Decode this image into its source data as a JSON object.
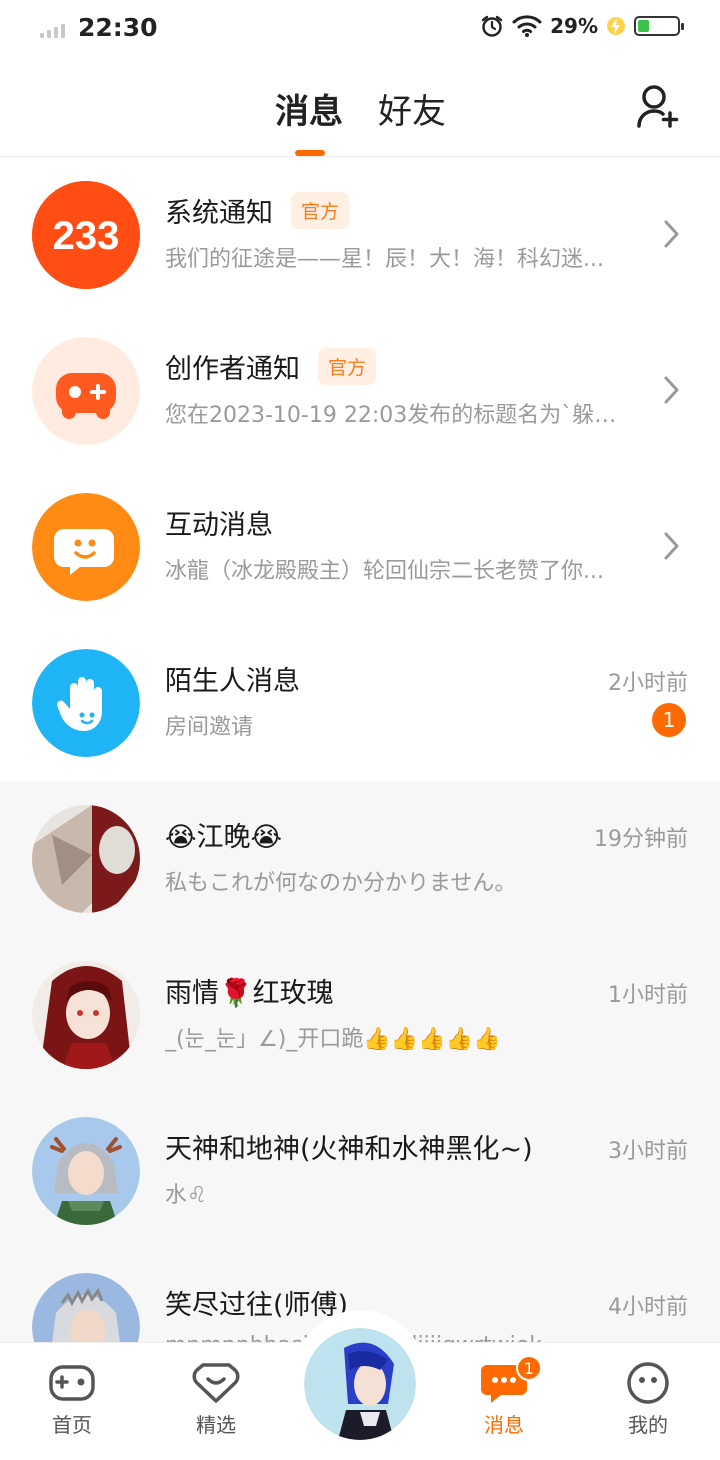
{
  "status_bar": {
    "time": "22:30",
    "battery_percent": "29%",
    "battery_level": 0.29
  },
  "header": {
    "tabs": [
      {
        "label": "消息",
        "active": true
      },
      {
        "label": "好友",
        "active": false
      }
    ],
    "add_friend_icon": "add-user-icon",
    "accent_color": "#ff6a00"
  },
  "system_rows": [
    {
      "name": "系统通知",
      "badge": "官方",
      "preview": "我们的征途是——星！辰！大！海！科幻迷...",
      "icon": "logo-233-icon"
    },
    {
      "name": "创作者通知",
      "badge": "官方",
      "preview": "您在2023-10-19 22:03发布的标题名为`躲避...",
      "icon": "gamepad-plus-icon"
    },
    {
      "name": "互动消息",
      "preview": "冰龍（冰龙殿殿主）轮回仙宗二长老赞了你...",
      "icon": "chat-smile-icon"
    },
    {
      "name": "陌生人消息",
      "preview": "房间邀请",
      "time": "2小时前",
      "unread": "1",
      "icon": "wave-hand-icon"
    }
  ],
  "chat_rows": [
    {
      "name": "😭江晚😭",
      "preview": "私もこれが何なのか分かりません。",
      "time": "19分钟前"
    },
    {
      "name": "雨情🌹红玫瑰",
      "preview": "_(눈_눈」∠)_开口跪👍👍👍👍👍",
      "time": "1小时前"
    },
    {
      "name": "天神和地神(火神和水神黑化~)",
      "preview": "水♌",
      "time": "3小时前"
    },
    {
      "name": "笑尽过往(师傅)",
      "preview": "mnmnnbbasiosjdjoknslijiigwrtwiek",
      "time": "4小时前"
    }
  ],
  "bottom_nav": [
    {
      "label": "首页",
      "icon": "gamepad-icon"
    },
    {
      "label": "精选",
      "icon": "heart-box-icon"
    },
    {
      "label": "消息",
      "icon": "message-icon",
      "active": true,
      "badge": "1"
    },
    {
      "label": "我的",
      "icon": "face-icon"
    }
  ]
}
